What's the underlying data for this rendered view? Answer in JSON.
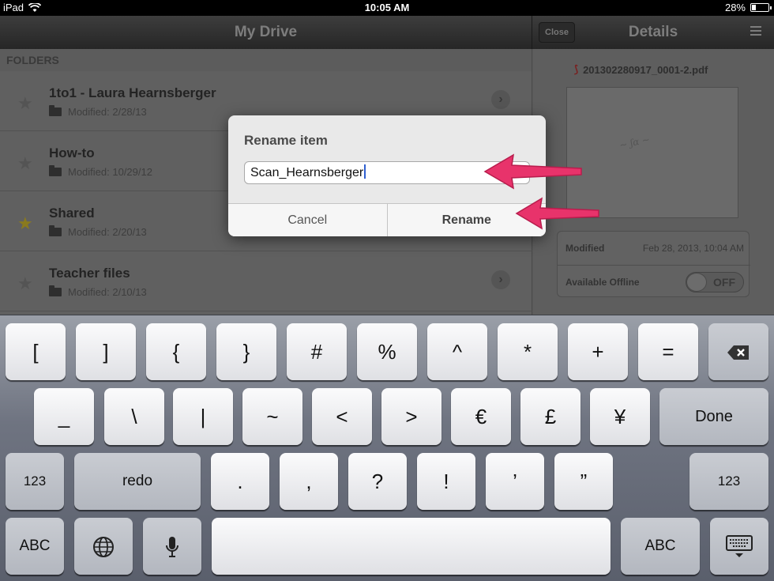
{
  "status_bar": {
    "device": "iPad",
    "time": "10:05 AM",
    "battery": "28%"
  },
  "nav": {
    "title": "My Drive",
    "close_label": "Close",
    "details_title": "Details"
  },
  "list": {
    "section_header": "FOLDERS",
    "items": [
      {
        "title": "1to1 - Laura Hearnsberger",
        "modified": "Modified: 2/28/13",
        "starred": false
      },
      {
        "title": "How-to",
        "modified": "Modified: 10/29/12",
        "starred": false
      },
      {
        "title": "Shared",
        "modified": "Modified: 2/20/13",
        "starred": true
      },
      {
        "title": "Teacher files",
        "modified": "Modified: 2/10/13",
        "starred": false
      }
    ]
  },
  "details": {
    "file_name": "201302280917_0001-2.pdf",
    "modified_label": "Modified",
    "modified_value": "Feb 28, 2013, 10:04 AM",
    "offline_label": "Available Offline",
    "offline_toggle": "OFF"
  },
  "dialog": {
    "title": "Rename item",
    "input_value": "Scan_Hearnsberger",
    "cancel_label": "Cancel",
    "rename_label": "Rename"
  },
  "annotation_color": "#e8336b",
  "keyboard": {
    "row1": [
      "[",
      "]",
      "{",
      "}",
      "#",
      "%",
      "^",
      "*",
      "+",
      "="
    ],
    "row2": [
      "_",
      "\\",
      "|",
      "~",
      "<",
      ">",
      "€",
      "£",
      "¥"
    ],
    "done_label": "Done",
    "row3": [
      ".",
      ",",
      "?",
      "!",
      "’",
      "”"
    ],
    "num_label": "123",
    "redo_label": "redo",
    "abc_label": "ABC"
  }
}
